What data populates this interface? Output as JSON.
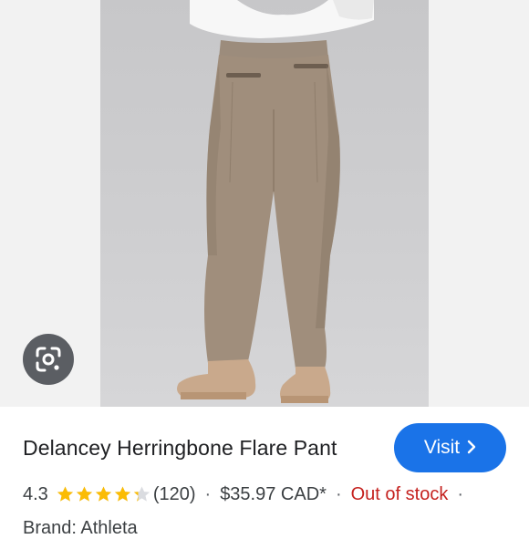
{
  "product": {
    "title": "Delancey Herringbone Flare Pant",
    "rating": "4.3",
    "rating_value": 4.3,
    "rating_max": 5,
    "review_count": "(120)",
    "price": "$35.97 CAD*",
    "stock_status": "Out of stock",
    "brand_line": "Brand: Athleta"
  },
  "actions": {
    "visit_label": "Visit",
    "lens_icon": "google-lens-icon",
    "visit_icon": "chevron-right-icon"
  },
  "separator": "·",
  "colors": {
    "accent": "#1a73e8",
    "star": "#fbbc04",
    "out_of_stock": "#c5221f",
    "text": "#202124"
  }
}
